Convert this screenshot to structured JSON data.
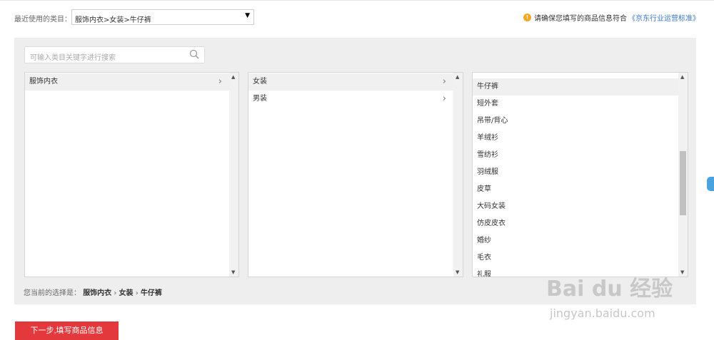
{
  "recent": {
    "label": "最近使用的类目：",
    "selected": "服饰内衣>女装>牛仔裤"
  },
  "notice": {
    "text": "请确保您填写的商品信息符合",
    "link": "《京东行业运营标准》"
  },
  "search": {
    "placeholder": "可输入类目关键字进行搜索"
  },
  "columns": {
    "level1": [
      {
        "label": "服饰内衣",
        "has_children": true,
        "selected": true
      }
    ],
    "level2": [
      {
        "label": "女装",
        "has_children": true,
        "selected": true
      },
      {
        "label": "男装",
        "has_children": true,
        "selected": false
      }
    ],
    "level3": [
      {
        "label": "牛仔裤",
        "selected": true
      },
      {
        "label": "短外套",
        "selected": false
      },
      {
        "label": "吊带/背心",
        "selected": false
      },
      {
        "label": "羊绒衫",
        "selected": false
      },
      {
        "label": "雪纺衫",
        "selected": false
      },
      {
        "label": "羽绒服",
        "selected": false
      },
      {
        "label": "皮草",
        "selected": false
      },
      {
        "label": "大码女装",
        "selected": false
      },
      {
        "label": "仿皮皮衣",
        "selected": false
      },
      {
        "label": "婚纱",
        "selected": false
      },
      {
        "label": "毛衣",
        "selected": false
      },
      {
        "label": "礼服",
        "selected": false
      }
    ]
  },
  "current": {
    "label": "您当前的选择是：",
    "path": [
      "服饰内衣",
      "女装",
      "牛仔裤"
    ]
  },
  "next_button": "下一步,填写商品信息",
  "watermark": {
    "mark": "Bai du 经验",
    "url": "jingyan.baidu.com"
  },
  "colors": {
    "accent_red": "#e4393c",
    "link_blue": "#3a76c9",
    "warning": "#f5a623",
    "panel_bg": "#eeeeee"
  }
}
